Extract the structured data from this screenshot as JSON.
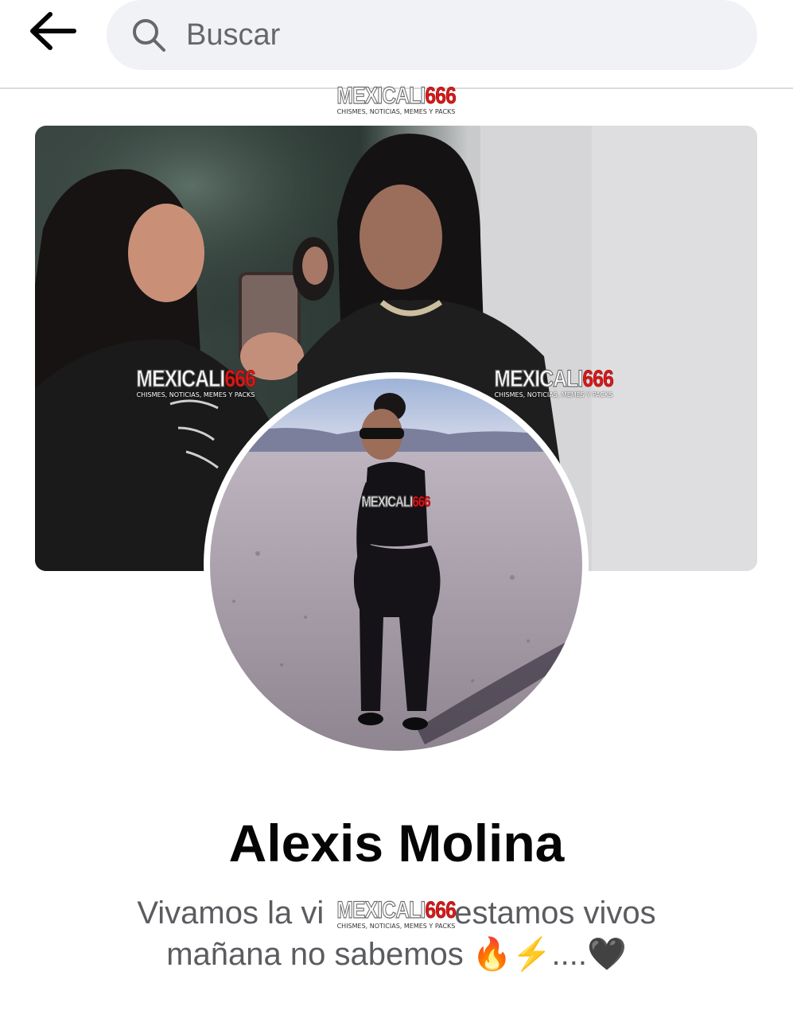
{
  "header": {
    "back_icon": "arrow-left-icon",
    "search": {
      "icon": "search-icon",
      "placeholder": "Buscar"
    }
  },
  "watermark": {
    "brand_main": "MEXICALI",
    "brand_number": "666",
    "tagline": "CHISMES, NOTICIAS, MEMES Y PACKS",
    "colors": {
      "number": "#d81a1a"
    }
  },
  "profile": {
    "name": "Alexis Molina",
    "bio_line1": "Vivamos la vi",
    "bio_line1_end": "estamos vivos",
    "bio_line2": "mañana no sabemos 🔥⚡....🖤"
  },
  "colors": {
    "search_bg": "#f0f2f5",
    "name_text": "#050505",
    "bio_text": "#5a5c60"
  }
}
